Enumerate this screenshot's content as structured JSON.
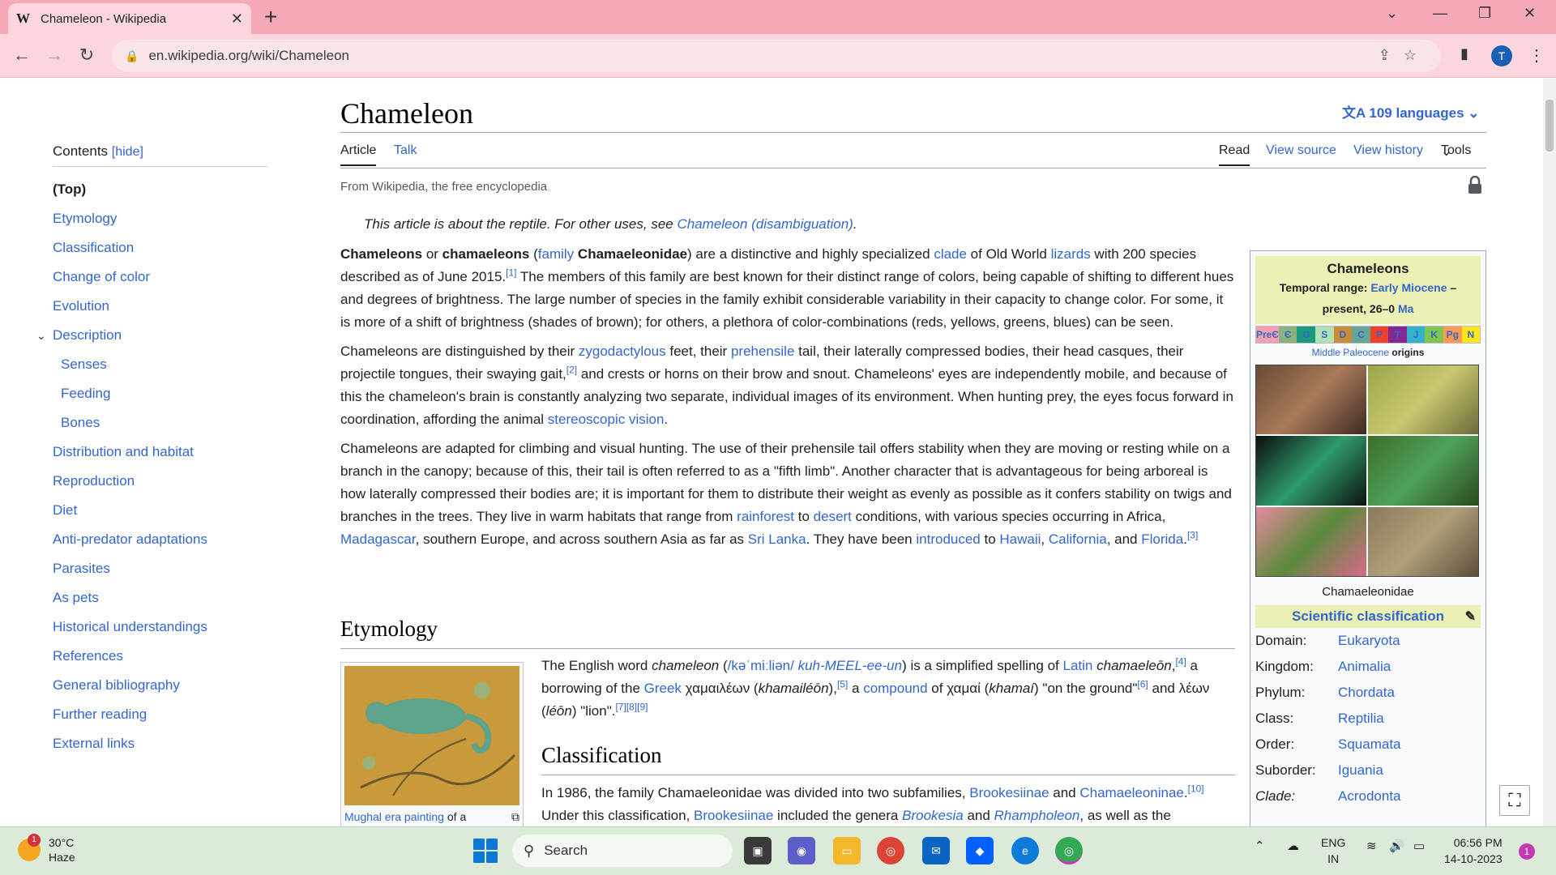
{
  "browser": {
    "tab_title": "Chameleon - Wikipedia",
    "tab_favicon": "W",
    "url": "en.wikipedia.org/wiki/Chameleon",
    "profile_initial": "T"
  },
  "sidebar": {
    "contents_label": "Contents",
    "hide_label": "[hide]",
    "items": [
      {
        "label": "(Top)"
      },
      {
        "label": "Etymology"
      },
      {
        "label": "Classification"
      },
      {
        "label": "Change of color"
      },
      {
        "label": "Evolution"
      },
      {
        "label": "Description"
      },
      {
        "label": "Senses"
      },
      {
        "label": "Feeding"
      },
      {
        "label": "Bones"
      },
      {
        "label": "Distribution and habitat"
      },
      {
        "label": "Reproduction"
      },
      {
        "label": "Diet"
      },
      {
        "label": "Anti-predator adaptations"
      },
      {
        "label": "Parasites"
      },
      {
        "label": "As pets"
      },
      {
        "label": "Historical understandings"
      },
      {
        "label": "References"
      },
      {
        "label": "General bibliography"
      },
      {
        "label": "Further reading"
      },
      {
        "label": "External links"
      }
    ]
  },
  "article": {
    "title": "Chameleon",
    "languages": "109 languages",
    "tab_article": "Article",
    "tab_talk": "Talk",
    "tab_read": "Read",
    "tab_view_source": "View source",
    "tab_view_history": "View history",
    "tab_tools": "Tools",
    "from": "From Wikipedia, the free encyclopedia",
    "hatnote_prefix": "This article is about the reptile. For other uses, see ",
    "hatnote_link": "Chameleon (disambiguation)",
    "hatnote_suffix": ".",
    "etymology_heading": "Etymology",
    "classification_heading": "Classification",
    "thumb_caption_link": "Mughal era painting",
    "thumb_caption_rest": " of a"
  },
  "infobox": {
    "name": "Chameleons",
    "range_label": "Temporal range: ",
    "range_link": "Early Miocene",
    "range_rest": " – present, 26–0 ",
    "range_unit": "Ma",
    "timeline": [
      "PreЄ",
      "Є",
      "O",
      "S",
      "D",
      "C",
      "P",
      "T",
      "J",
      "K",
      "Pg",
      "N"
    ],
    "origin_link": "Middle Paleocene",
    "origin_rest": " origins",
    "image_caption": "Chamaeleonidae",
    "sci_heading": "Scientific classification",
    "taxonomy": [
      {
        "rank": "Domain:",
        "value": "Eukaryota"
      },
      {
        "rank": "Kingdom:",
        "value": "Animalia"
      },
      {
        "rank": "Phylum:",
        "value": "Chordata"
      },
      {
        "rank": "Class:",
        "value": "Reptilia"
      },
      {
        "rank": "Order:",
        "value": "Squamata"
      },
      {
        "rank": "Suborder:",
        "value": "Iguania"
      },
      {
        "rank": "Clade:",
        "value": "Acrodonta"
      }
    ]
  },
  "taskbar": {
    "temperature": "30°C",
    "weather": "Haze",
    "weather_badge": "1",
    "search_placeholder": "Search",
    "lang_1": "ENG",
    "lang_2": "IN",
    "time": "06:56 PM",
    "date": "14-10-2023",
    "notifications": "1"
  },
  "colors": {
    "link": "#3366cc",
    "tabstrip": "#f6a9b6",
    "toolbar": "#fbd6dc",
    "taskbar": "#dcebd9",
    "infobox_header": "#ebf1b4"
  }
}
